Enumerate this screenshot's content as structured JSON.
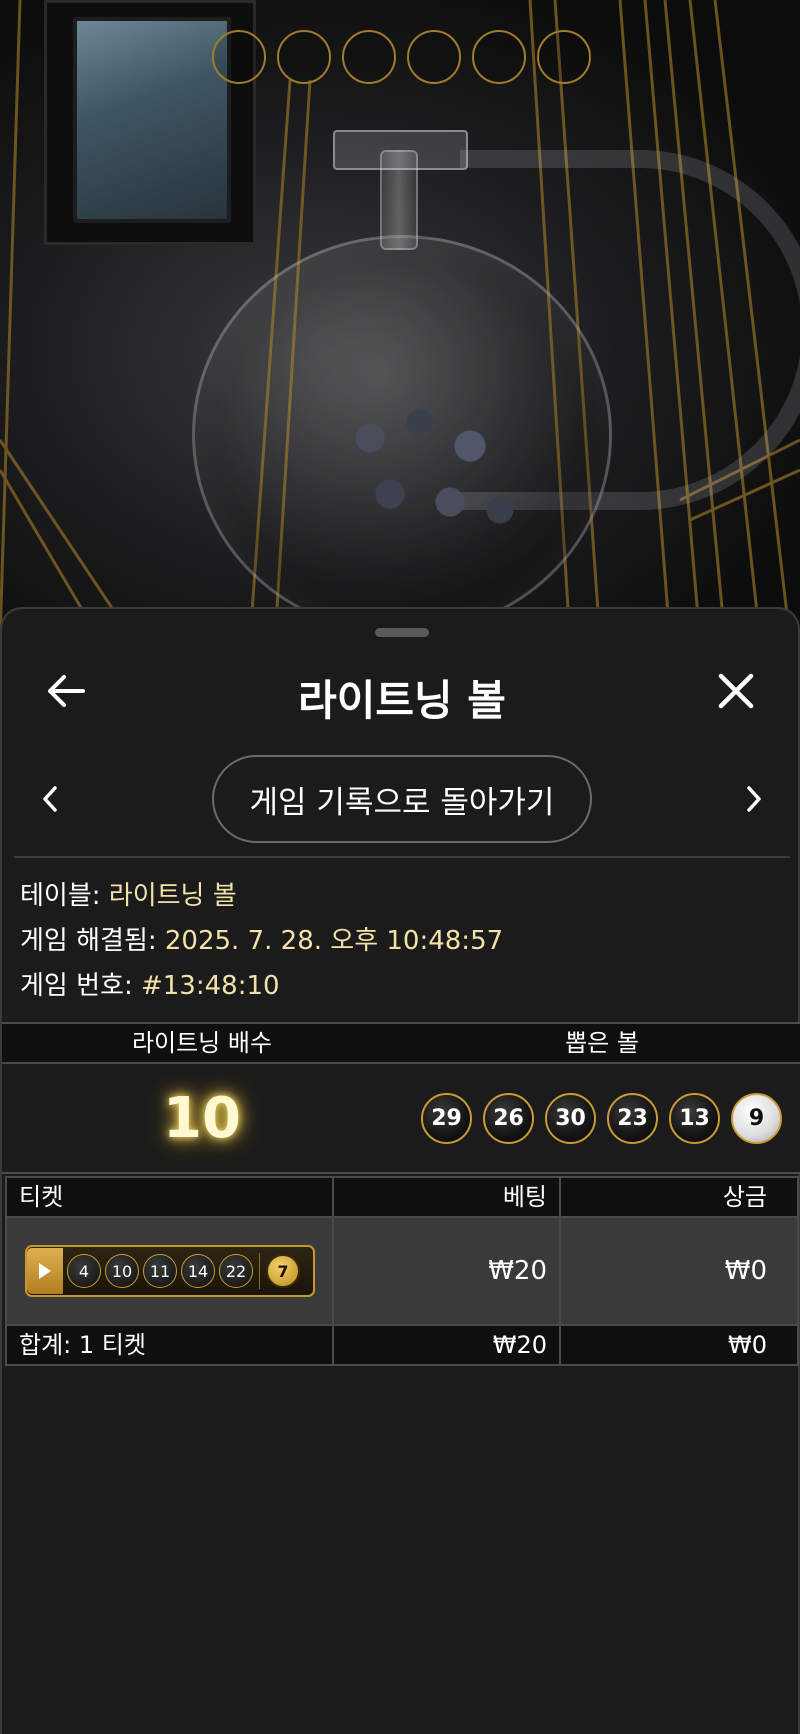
{
  "background": {
    "ball_slot_count": 6
  },
  "sheet": {
    "title": "라이트닝 볼",
    "back_history_label": "게임 기록으로 돌아가기",
    "info": {
      "table_key": "테이블:",
      "table_value": "라이트닝 볼",
      "resolved_key": "게임 해결됨:",
      "resolved_value": "2025. 7. 28. 오후 10:48:57",
      "game_no_key": "게임 번호:",
      "game_no_value": "#13:48:10"
    },
    "result_table": {
      "headers": [
        "라이트닝 배수",
        "뽑은 볼"
      ],
      "multiplier": "10",
      "drawn_balls": [
        "29",
        "26",
        "30",
        "23",
        "13"
      ],
      "bonus_ball": "9"
    },
    "ticket_table": {
      "headers": [
        "티켓",
        "베팅",
        "상금"
      ],
      "ticket": {
        "numbers": [
          "4",
          "10",
          "11",
          "14",
          "22"
        ],
        "bonus": "7",
        "bet": "₩20",
        "prize": "₩0"
      },
      "total_label": "합계: 1 티켓",
      "total_bet": "₩20",
      "total_prize": "₩0"
    }
  },
  "colors": {
    "accent_gold": "#c99b32",
    "info_value": "#f3e2a8"
  }
}
